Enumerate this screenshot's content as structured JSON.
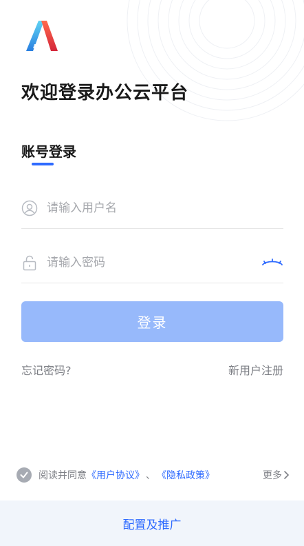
{
  "header": {
    "logo_icon": "app-logo-A",
    "welcome_text": "欢迎登录办公云平台"
  },
  "tabs": {
    "active_label": "账号登录"
  },
  "form": {
    "username_placeholder": "请输入用户名",
    "username_value": "",
    "username_icon": "user-icon",
    "password_placeholder": "请输入密码",
    "password_value": "",
    "password_icon": "lock-icon",
    "toggle_icon": "eye-closed-icon",
    "login_label": "登录",
    "forgot_label": "忘记密码?",
    "register_label": "新用户注册"
  },
  "agreement": {
    "prefix": "阅读并同意",
    "user_agreement": "《用户协议》",
    "separator": "、",
    "privacy_policy": "《隐私政策》",
    "more_label": "更多"
  },
  "footer": {
    "config_label": "配置及推广"
  },
  "colors": {
    "accent": "#2f6bff",
    "login_button": "#97b9fb",
    "muted_text": "#7d7f85",
    "footer_bg": "#f1f5fb"
  }
}
